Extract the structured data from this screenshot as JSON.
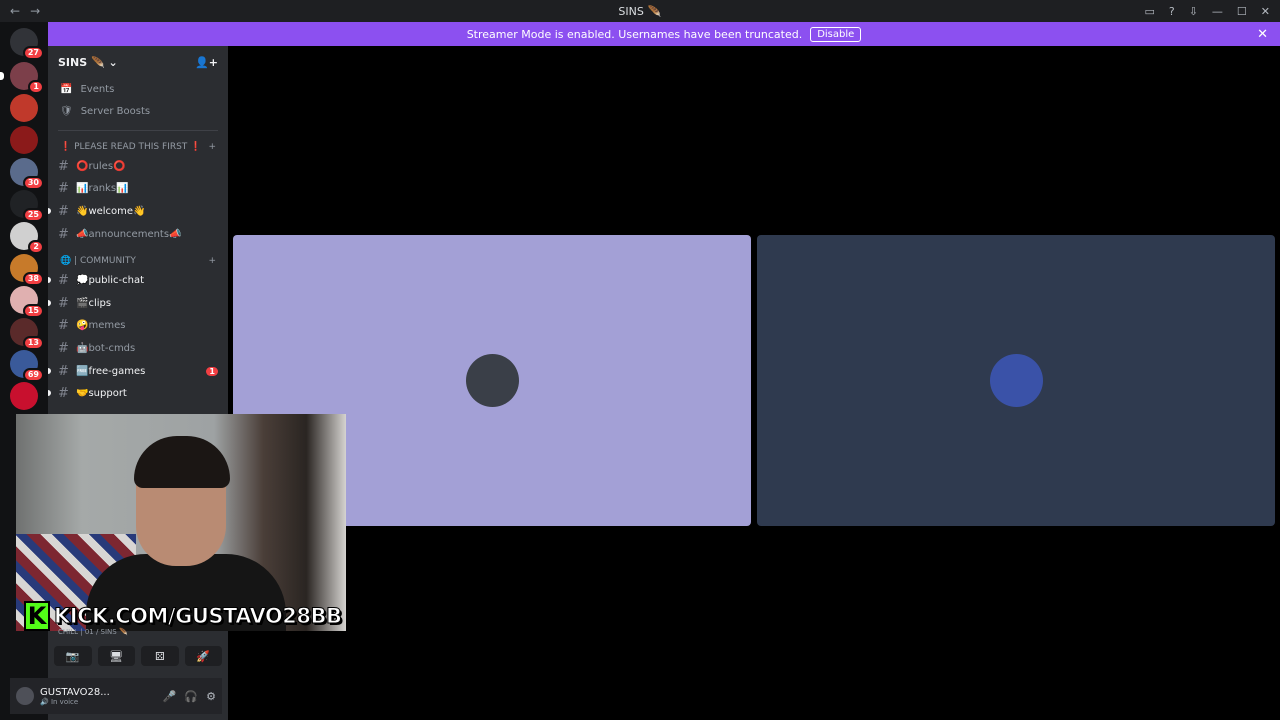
{
  "titlebar": {
    "title": "SINS",
    "title_icon": "🪶"
  },
  "banner": {
    "message": "Streamer Mode is enabled. Usernames have been truncated.",
    "disable_label": "Disable",
    "close": "✕"
  },
  "rail": {
    "home_badge": "27",
    "servers": [
      {
        "badge": "1",
        "color": "#7c3f4a"
      },
      {
        "badge": "",
        "color": "#c0392b"
      },
      {
        "badge": "",
        "color": "#8b1a1a"
      },
      {
        "badge": "30",
        "color": "#5a6b8c"
      },
      {
        "badge": "25",
        "color": "#202225"
      },
      {
        "badge": "2",
        "color": "#d0d0d0"
      },
      {
        "badge": "38",
        "color": "#c77a2a"
      },
      {
        "badge": "15",
        "color": "#e0b0b0"
      },
      {
        "badge": "13",
        "color": "#5a2a2a"
      },
      {
        "badge": "69",
        "color": "#3a5a9a"
      },
      {
        "badge": "",
        "color": "#c8102e"
      }
    ]
  },
  "sidebar": {
    "server_name": "SINS 🪶",
    "misc": [
      {
        "icon": "📅",
        "label": "Events"
      },
      {
        "icon": "🛡",
        "label": "Server Boosts"
      }
    ],
    "categories": [
      {
        "name": "❗ PLEASE READ THIS FIRST ❗",
        "channels": [
          {
            "name": "⭕rules⭕",
            "unread": false,
            "mention": ""
          },
          {
            "name": "📊ranks📊",
            "unread": false,
            "mention": ""
          },
          {
            "name": "👋welcome👋",
            "unread": true,
            "mention": ""
          },
          {
            "name": "📣announcements📣",
            "unread": false,
            "mention": ""
          }
        ]
      },
      {
        "name": "🌐 | COMMUNITY",
        "channels": [
          {
            "name": "💭public-chat",
            "unread": true,
            "mention": ""
          },
          {
            "name": "🎬clips",
            "unread": true,
            "mention": ""
          },
          {
            "name": "🤪memes",
            "unread": false,
            "mention": ""
          },
          {
            "name": "🤖bot-cmds",
            "unread": false,
            "mention": ""
          },
          {
            "name": "🆓free-games",
            "unread": true,
            "mention": "1"
          },
          {
            "name": "🤝support",
            "unread": true,
            "mention": ""
          }
        ]
      }
    ]
  },
  "voice": {
    "channel_info": "CHILL | 01 / SINS 🪶",
    "buttons": [
      "📷",
      "🖥",
      "⚄",
      "🚀"
    ]
  },
  "user": {
    "name": "GUSTAVO28...",
    "status": "In voice"
  },
  "stage": {
    "tiles": [
      {
        "bg": "#a3a0d6",
        "avatar_color": "#3a3f48"
      },
      {
        "bg": "#2f3a4f",
        "avatar_color": "#3a52a8"
      }
    ]
  },
  "overlay": {
    "kick_logo": "K",
    "kick_url": "KICK.COM/GUSTAVO28BB"
  }
}
